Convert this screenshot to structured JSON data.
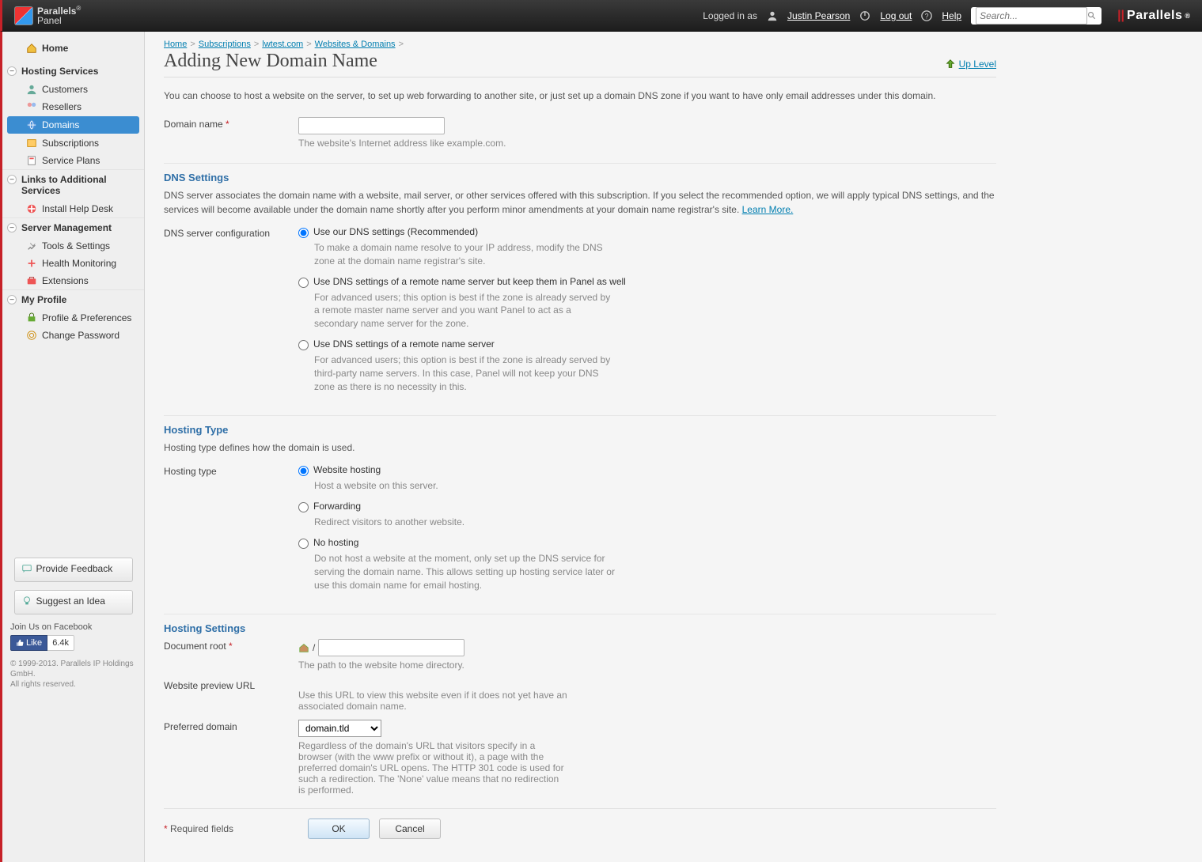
{
  "header": {
    "product": "Parallels",
    "product_sub": "Panel",
    "logged_in_as": "Logged in as",
    "username": "Justin Pearson",
    "logout": "Log out",
    "help": "Help",
    "search_placeholder": "Search...",
    "brand": "Parallels"
  },
  "sidebar": {
    "home": "Home",
    "groups": [
      {
        "title": "Hosting Services",
        "items": [
          "Customers",
          "Resellers",
          "Domains",
          "Subscriptions",
          "Service Plans"
        ],
        "active_index": 2
      },
      {
        "title": "Links to Additional Services",
        "items": [
          "Install Help Desk"
        ]
      },
      {
        "title": "Server Management",
        "items": [
          "Tools & Settings",
          "Health Monitoring",
          "Extensions"
        ]
      },
      {
        "title": "My Profile",
        "items": [
          "Profile & Preferences",
          "Change Password"
        ]
      }
    ],
    "feedback": "Provide Feedback",
    "suggest": "Suggest an Idea",
    "fb_join": "Join Us on Facebook",
    "fb_like": "Like",
    "fb_count": "6.4k",
    "copyright": "© 1999-2013. Parallels IP Holdings GmbH.",
    "rights": "All rights reserved."
  },
  "breadcrumb": [
    "Home",
    "Subscriptions",
    "lwtest.com",
    "Websites & Domains"
  ],
  "page": {
    "title": "Adding New Domain Name",
    "uplevel": "Up Level"
  },
  "form": {
    "intro": "You can choose to host a website on the server, to set up web forwarding to another site, or just set up a domain DNS zone if you want to have only email addresses under this domain.",
    "domain_label": "Domain name",
    "domain_value": "",
    "domain_hint": "The website's Internet address like example.com.",
    "dns": {
      "title": "DNS Settings",
      "desc": "DNS server associates the domain name with a website, mail server, or other services offered with this subscription. If you select the recommended option, we will apply typical DNS settings, and the services will become available under the domain name shortly after you perform minor amendments at your domain name registrar's site. ",
      "learn_more": "Learn More.",
      "field_label": "DNS server configuration",
      "opts": [
        {
          "label": "Use our DNS settings (Recommended)",
          "hint": "To make a domain name resolve to your IP address, modify the DNS zone at the domain name registrar's site."
        },
        {
          "label": "Use DNS settings of a remote name server but keep them in Panel as well",
          "hint": "For advanced users; this option is best if the zone is already served by a remote master name server and you want Panel to act as a secondary name server for the zone."
        },
        {
          "label": "Use DNS settings of a remote name server",
          "hint": "For advanced users; this option is best if the zone is already served by third-party name servers. In this case, Panel will not keep your DNS zone as there is no necessity in this."
        }
      ],
      "selected": 0
    },
    "hosting_type": {
      "title": "Hosting Type",
      "desc": "Hosting type defines how the domain is used.",
      "field_label": "Hosting type",
      "opts": [
        {
          "label": "Website hosting",
          "hint": "Host a website on this server."
        },
        {
          "label": "Forwarding",
          "hint": "Redirect visitors to another website."
        },
        {
          "label": "No hosting",
          "hint": "Do not host a website at the moment, only set up the DNS service for serving the domain name. This allows setting up hosting service later or use this domain name for email hosting."
        }
      ],
      "selected": 0
    },
    "hosting_settings": {
      "title": "Hosting Settings",
      "docroot_label": "Document root",
      "docroot_prefix": "/",
      "docroot_value": "",
      "docroot_hint": "The path to the website home directory.",
      "preview_label": "Website preview URL",
      "preview_hint": "Use this URL to view this website even if it does not yet have an associated domain name.",
      "preferred_label": "Preferred domain",
      "preferred_value": "domain.tld",
      "preferred_hint": "Regardless of the domain's URL that visitors specify in a browser (with the www prefix or without it), a page with the preferred domain's URL opens. The HTTP 301 code is used for such a redirection. The 'None' value means that no redirection is performed."
    },
    "required_label": "Required fields",
    "ok": "OK",
    "cancel": "Cancel"
  },
  "icons": {
    "user": "person-icon",
    "power": "power-icon",
    "help": "help-icon",
    "search": "search-icon"
  },
  "colors": {
    "accent": "#3b8dd1",
    "link": "#007eb0",
    "req": "#c62128",
    "section": "#2f6fa7"
  }
}
